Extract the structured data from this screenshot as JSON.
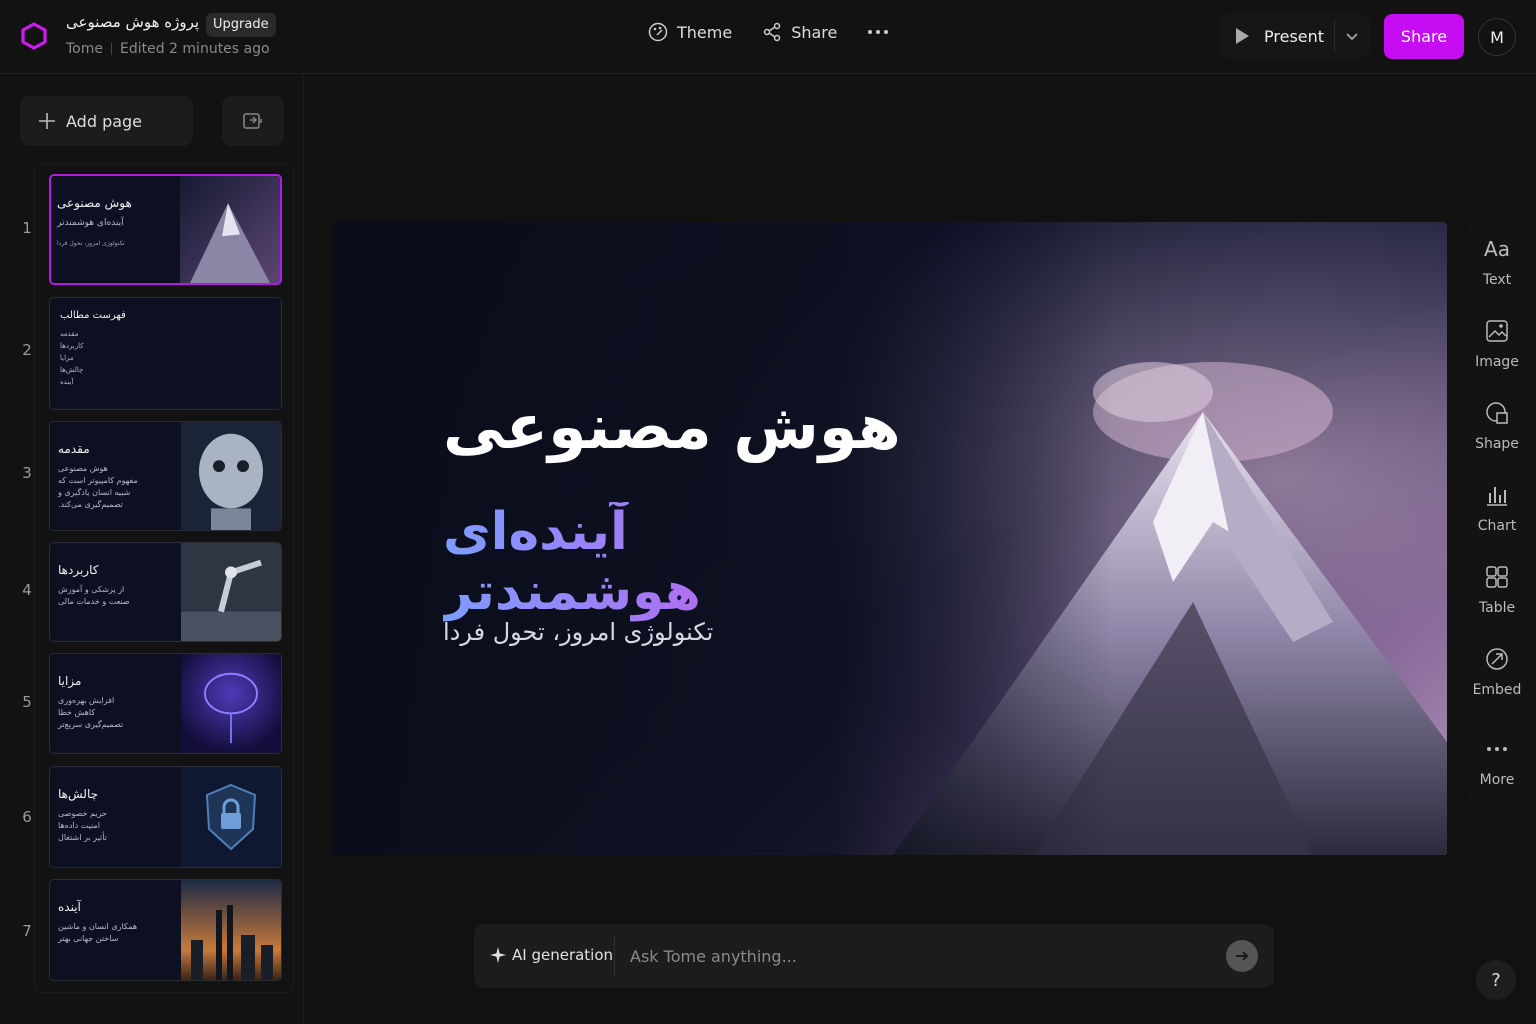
{
  "app": {
    "brand_color": "#c60cf2"
  },
  "header": {
    "project_title": "پروژه هوش مصنوعی",
    "upgrade_label": "Upgrade",
    "app_name": "Tome",
    "edited": "Edited 2 minutes ago",
    "theme_label": "Theme",
    "share_link_label": "Share",
    "present_label": "Present",
    "share_button_label": "Share",
    "avatar_initial": "M"
  },
  "sidebar": {
    "add_page_label": "Add page",
    "slides": [
      {
        "num": "1",
        "title": "هوش مصنوعی",
        "sub": "آینده‌ای هوشمندتر",
        "small": "تکنولوژی امروز، تحول فردا",
        "lines": []
      },
      {
        "num": "2",
        "title": "فهرست مطالب",
        "sub": "",
        "small": "",
        "lines": [
          "مقدمه",
          "کاربردها",
          "مزایا",
          "چالش‌ها",
          "آینده"
        ]
      },
      {
        "num": "3",
        "title": "مقدمه",
        "sub": "",
        "small": "",
        "lines": [
          "هوش مصنوعی",
          "مفهوم کامپیوتر است که",
          "شبیه انسان یادگیری و",
          "تصمیم‌گیری می‌کند."
        ]
      },
      {
        "num": "4",
        "title": "کاربردها",
        "sub": "",
        "small": "",
        "lines": [
          "از پزشکی و آموزش",
          "صنعت و خدمات مالی"
        ]
      },
      {
        "num": "5",
        "title": "مزایا",
        "sub": "",
        "small": "",
        "lines": [
          "افزایش بهره‌وری",
          "کاهش خطا",
          "تصمیم‌گیری سریع‌تر"
        ]
      },
      {
        "num": "6",
        "title": "چالش‌ها",
        "sub": "",
        "small": "",
        "lines": [
          "حریم خصوصی",
          "امنیت داده‌ها",
          "تأثیر بر اشتغال"
        ]
      },
      {
        "num": "7",
        "title": "آینده",
        "sub": "",
        "small": "",
        "lines": [
          "همکاری انسان و ماشین",
          "ساختن جهانی بهتر"
        ]
      }
    ]
  },
  "slide": {
    "title": "هوش مصنوعی",
    "subtitle": "آینده‌ای هوشمندتر",
    "tagline": "تکنولوژی امروز، تحول فردا"
  },
  "toolbar": {
    "items": [
      {
        "label": "Text",
        "icon": "text-icon"
      },
      {
        "label": "Image",
        "icon": "image-icon"
      },
      {
        "label": "Shape",
        "icon": "shape-icon"
      },
      {
        "label": "Chart",
        "icon": "chart-icon"
      },
      {
        "label": "Table",
        "icon": "table-icon"
      },
      {
        "label": "Embed",
        "icon": "embed-icon"
      },
      {
        "label": "More",
        "icon": "more-icon"
      }
    ]
  },
  "ai": {
    "label": "AI generation",
    "placeholder": "Ask Tome anything..."
  },
  "help": {
    "label": "?"
  }
}
